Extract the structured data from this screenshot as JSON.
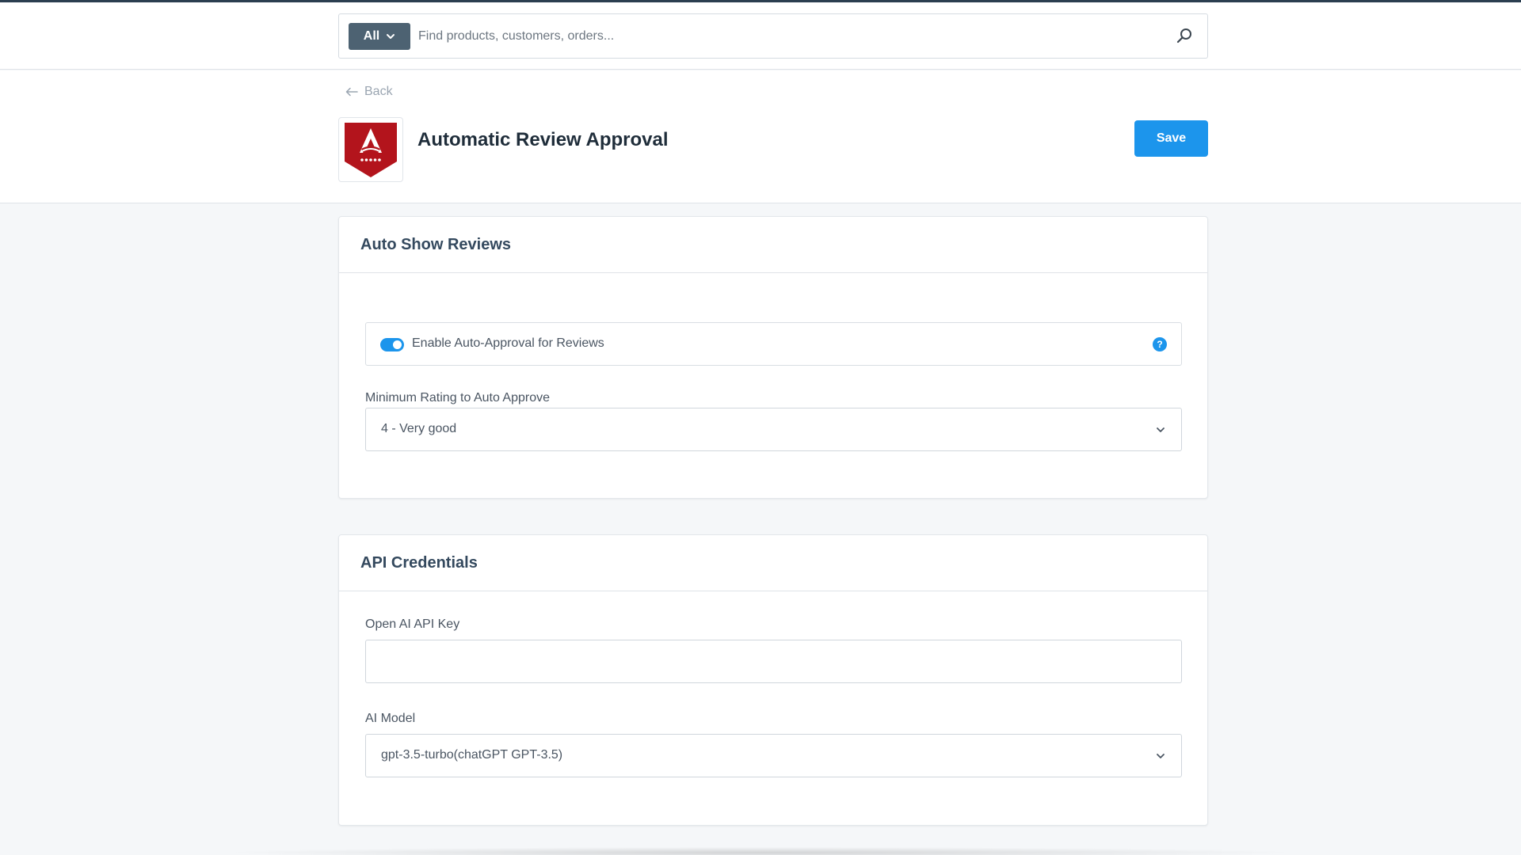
{
  "search": {
    "scope_label": "All",
    "placeholder": "Find products, customers, orders...",
    "value": ""
  },
  "header": {
    "back_label": "Back",
    "title": "Automatic Review Approval",
    "save_label": "Save"
  },
  "colors": {
    "accent": "#1c95ec",
    "logo_red": "#b3141c",
    "scope_bg": "#4d6272"
  },
  "auto_show": {
    "title": "Auto Show Reviews",
    "toggle_label": "Enable Auto-Approval for Reviews",
    "toggle_on": true,
    "min_rating_label": "Minimum Rating to Auto Approve",
    "min_rating_value": "4 - Very good"
  },
  "api": {
    "title": "API Credentials",
    "key_label": "Open AI API Key",
    "key_value": "",
    "model_label": "AI Model",
    "model_value": "gpt-3.5-turbo(chatGPT GPT-3.5)"
  }
}
